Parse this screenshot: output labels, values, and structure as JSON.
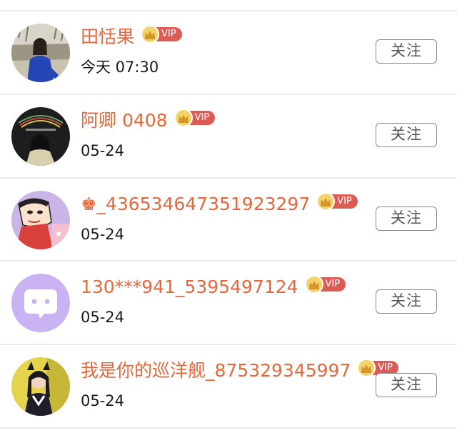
{
  "follow_label": "关注",
  "vip_label": "VIP",
  "colors": {
    "name": "#e5673b",
    "vip_badge": "#dc5c55",
    "crown": "#f5d36b",
    "divider": "#ebebeb"
  },
  "users": [
    {
      "name": "田恬果",
      "time": "今天 07:30",
      "vip": true,
      "avatar": "photo-woman-blue-sweater"
    },
    {
      "name": "阿卿 0408",
      "time": "05-24",
      "vip": true,
      "avatar": "photo-woman-dark"
    },
    {
      "name_prefix_icon": "crown-suit-icon",
      "name": "_436534647351923297",
      "time": "05-24",
      "vip": true,
      "avatar": "cartoon-crayon-shin-chan"
    },
    {
      "name": "130***941_5395497124",
      "time": "05-24",
      "vip": true,
      "avatar": "default-chat-bubble"
    },
    {
      "name": "我是你的巡洋舰_875329345997",
      "time": "05-24",
      "vip": true,
      "avatar": "photo-girl-cat-ears"
    }
  ]
}
